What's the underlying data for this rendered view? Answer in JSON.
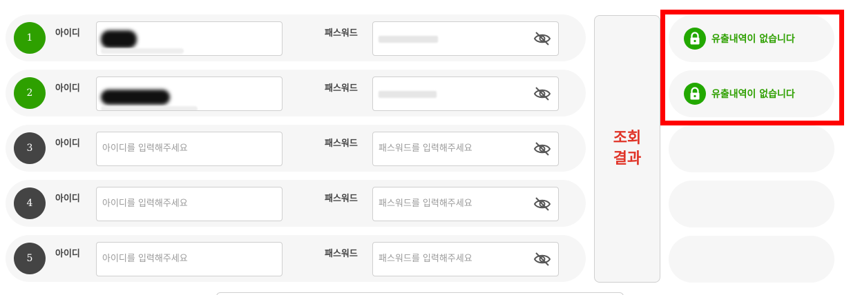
{
  "form": {
    "id_label": "아이디",
    "pw_label": "패스워드",
    "id_placeholder": "아이디를 입력해주세요",
    "pw_placeholder": "패스워드를 입력해주세요",
    "rows": [
      {
        "number": "1",
        "status": "filled"
      },
      {
        "number": "2",
        "status": "filled"
      },
      {
        "number": "3",
        "status": "empty"
      },
      {
        "number": "4",
        "status": "empty"
      },
      {
        "number": "5",
        "status": "empty"
      }
    ]
  },
  "result_button": {
    "line1": "조회",
    "line2": "결과"
  },
  "results": [
    {
      "text": "유출내역이 없습니다",
      "icon": "lock-icon"
    },
    {
      "text": "유출내역이 없습니다",
      "icon": "lock-icon"
    }
  ],
  "colors": {
    "accent_green": "#2ea000",
    "dark_circle": "#444444",
    "result_red": "#e03327",
    "highlight_red": "#ff0000"
  }
}
